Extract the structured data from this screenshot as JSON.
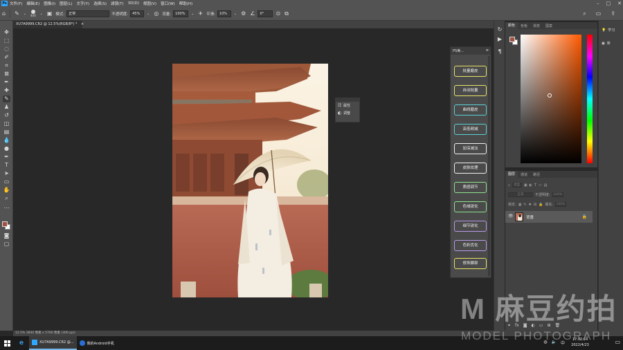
{
  "app": {
    "logo": "Ps"
  },
  "menu": [
    "文件(F)",
    "编辑(E)",
    "图像(I)",
    "图层(L)",
    "文字(Y)",
    "选择(S)",
    "滤镜(T)",
    "3D(D)",
    "视图(V)",
    "窗口(W)",
    "帮助(H)"
  ],
  "options": {
    "brush_size": "400",
    "mode_label": "模式:",
    "mode_value": "正常",
    "opacity_label": "不透明度:",
    "opacity_value": "45%",
    "flow_label": "流量:",
    "flow_value": "100%",
    "smooth_label": "平滑:",
    "smooth_value": "10%",
    "angle_value": "0°"
  },
  "document_tab": {
    "title": "XU7A9999.CR2 @ 12.5%(RGB/8*) *",
    "close": "×"
  },
  "properties_panel": {
    "items": [
      {
        "label": "属性"
      },
      {
        "label": "调整"
      }
    ]
  },
  "plugin_panel": {
    "title": "PS美...",
    "buttons": [
      {
        "label": "批量磨皮",
        "color": "#e8e36a"
      },
      {
        "label": "自动批量",
        "color": "#e8e36a"
      },
      {
        "label": "曲线磨皮",
        "color": "#5ad0d6"
      },
      {
        "label": "高低频减",
        "color": "#5ad0d6"
      },
      {
        "label": "加深减淡",
        "color": "#f0f0f0"
      },
      {
        "label": "皮肤纹理",
        "color": "#f0f0f0"
      },
      {
        "label": "质感调节",
        "color": "#8fe38f"
      },
      {
        "label": "色域锐化",
        "color": "#8fe38f"
      },
      {
        "label": "细节锐化",
        "color": "#b99ae8"
      },
      {
        "label": "色彩优化",
        "color": "#b99ae8"
      },
      {
        "label": "修饰脚部",
        "color": "#e8e36a"
      }
    ]
  },
  "color_panel": {
    "tabs": [
      "颜色",
      "色板",
      "渐变",
      "图案"
    ],
    "foreground": "#a0523d",
    "background": "#ffffff"
  },
  "layers_panel": {
    "tabs": [
      "图层",
      "通道",
      "路径"
    ],
    "kind_label": "类型",
    "blend_mode": "正常",
    "opacity_label": "不透明度:",
    "opacity_value": "100%",
    "lock_label": "锁定:",
    "fill_label": "填充:",
    "fill_value": "100%",
    "layer_name": "背景"
  },
  "learn_panel": {
    "items": [
      {
        "label": "学习"
      },
      {
        "label": "库"
      }
    ]
  },
  "status": {
    "text": "12.5%    3840 像素 x 5760 像素 (300 ppi)"
  },
  "taskbar": {
    "apps": [
      {
        "label": "XU7A9999.CR2 @..."
      },
      {
        "label": "我的Android手机"
      }
    ],
    "time": "17:02:24",
    "date": "2022/4/23"
  },
  "watermark": {
    "main": "M 麻豆约拍",
    "sub": "MODEL PHOTOGRAPH"
  }
}
